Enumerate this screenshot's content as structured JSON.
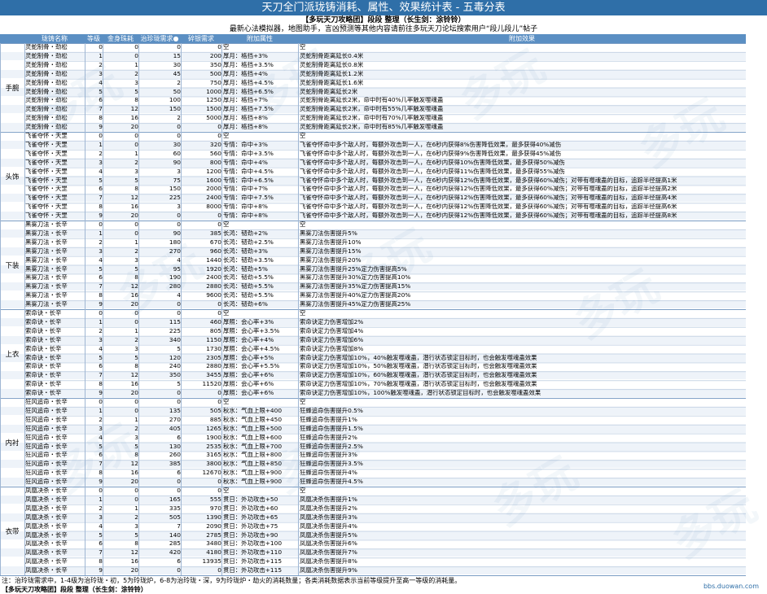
{
  "title": "天刀全门派珑铸消耗、属性、效果统计表 - 五毒分表",
  "credit": "【多玩天刀攻略团】段段 整理（长生剑：涂铃铃）",
  "intro": "最新心法模拟器，地图助手，言凶预测等其他内容请前往多玩天刀论坛搜索用户“段儿段儿”帖子",
  "headers": [
    "珑铸名称",
    "等级",
    "金身珠耗",
    "治珍珑需求●",
    "碎银需求",
    "附加属性",
    "附加效果"
  ],
  "sections": [
    {
      "name": "手腕",
      "item": "灵蛇制骨・劲松",
      "rows": [
        [
          "0",
          "0",
          "0",
          "0",
          "空",
          "空"
        ],
        [
          "1",
          "0",
          "15",
          "200",
          "厚月：格挡+3%",
          "灵蛇制骨距离延长0.4米"
        ],
        [
          "2",
          "1",
          "30",
          "350",
          "厚月：格挡+3.5%",
          "灵蛇制骨距离延长0.8米"
        ],
        [
          "3",
          "2",
          "45",
          "500",
          "厚月：格挡+4%",
          "灵蛇制骨距离延长1.2米"
        ],
        [
          "4",
          "3",
          "2",
          "750",
          "厚月：格挡+4.5%",
          "灵蛇制骨距离延长1.6米"
        ],
        [
          "5",
          "5",
          "50",
          "1000",
          "厚月：格挡+6.5%",
          "灵蛇制骨距离延长2米"
        ],
        [
          "6",
          "8",
          "100",
          "1250",
          "厚月：格挡+7%",
          "灵蛇制骨距离延长2米，命中时有40%几率触发噬魂蛊"
        ],
        [
          "7",
          "12",
          "150",
          "1500",
          "厚月：格挡+7.5%",
          "灵蛇制骨距离延长2米，命中时有55%几率触发噬魂蛊"
        ],
        [
          "8",
          "16",
          "2",
          "5000",
          "厚月：格挡+8%",
          "灵蛇制骨距离延长2米，命中时有70%几率触发噬魂蛊"
        ],
        [
          "9",
          "20",
          "0",
          "0",
          "厚月：格挡+8%",
          "灵蛇制骨距离延长2米，命中时有85%几率触发噬魂蛊"
        ]
      ]
    },
    {
      "name": "头饰",
      "item": "飞雀夺怀・天罡",
      "rows": [
        [
          "0",
          "0",
          "0",
          "0",
          "空",
          "空"
        ],
        [
          "1",
          "0",
          "30",
          "320",
          "专情：命中+3%",
          "飞雀夺怀命中多个敌人时，每额外攻击到一人，在6秒内获得8%伤害降低效果，最多获得40%减伤"
        ],
        [
          "2",
          "1",
          "60",
          "560",
          "专情：命中+3.5%",
          "飞雀夺怀命中多个敌人时，每额外攻击到一人，在6秒内获得9%伤害降低效果，最多获得45%减伤"
        ],
        [
          "3",
          "2",
          "90",
          "800",
          "专情：命中+4%",
          "飞雀夺怀命中多个敌人时，每额外攻击到一人，在6秒内获得10%伤害降低效果，最多获得50%减伤"
        ],
        [
          "4",
          "3",
          "3",
          "1200",
          "专情：命中+4.5%",
          "飞雀夺怀命中多个敌人时，每额外攻击到一人，在6秒内获得11%伤害降低效果，最多获得55%减伤"
        ],
        [
          "5",
          "5",
          "75",
          "1600",
          "专情：命中+6.5%",
          "飞雀夺怀命中多个敌人时，每额外攻击到一人，在6秒内获得12%伤害降低效果，最多获得60%减伤；对带有噬魂蛊的目标，追踪半径提高1米"
        ],
        [
          "6",
          "8",
          "150",
          "2000",
          "专情：命中+7%",
          "飞雀夺怀命中多个敌人时，每额外攻击到一人，在6秒内获得12%伤害降低效果，最多获得60%减伤；对带有噬魂蛊的目标，追踪半径提高2米"
        ],
        [
          "7",
          "12",
          "225",
          "2400",
          "专情：命中+7.5%",
          "飞雀夺怀命中多个敌人时，每额外攻击到一人，在6秒内获得12%伤害降低效果，最多获得60%减伤；对带有噬魂蛊的目标，追踪半径提高4米"
        ],
        [
          "8",
          "16",
          "3",
          "8000",
          "专情：命中+8%",
          "飞雀夺怀命中多个敌人时，每额外攻击到一人，在6秒内获得12%伤害降低效果，最多获得60%减伤；对带有噬魂蛊的目标，追踪半径提高6米"
        ],
        [
          "9",
          "20",
          "0",
          "0",
          "专情：命中+8%",
          "飞雀夺怀命中多个敌人时，每额外攻击到一人，在6秒内获得12%伤害降低效果，最多获得60%减伤；对带有噬魂蛊的目标，追踪半径提高8米"
        ]
      ]
    },
    {
      "name": "下装",
      "item": "黑雾刀法・长辛",
      "rows": [
        [
          "0",
          "0",
          "0",
          "0",
          "空",
          "空"
        ],
        [
          "1",
          "0",
          "90",
          "385",
          "长鸿：韧劲+2%",
          "黑雾刀法伤害提升5%"
        ],
        [
          "2",
          "1",
          "180",
          "670",
          "长鸿：韧劲+2.5%",
          "黑雾刀法伤害提升10%"
        ],
        [
          "3",
          "2",
          "270",
          "960",
          "长鸿：韧劲+3%",
          "黑雾刀法伤害提升15%"
        ],
        [
          "4",
          "3",
          "4",
          "1440",
          "长鸿：韧劲+3.5%",
          "黑雾刀法伤害提升20%"
        ],
        [
          "5",
          "5",
          "95",
          "1920",
          "长鸿：韧劲+5%",
          "黑雾刀法伤害提升25%定力伤害提高5%"
        ],
        [
          "6",
          "8",
          "190",
          "2400",
          "长鸿：韧劲+5.5%",
          "黑雾刀法伤害提升30%定力伤害提高10%"
        ],
        [
          "7",
          "12",
          "280",
          "2880",
          "长鸿：韧劲+5.5%",
          "黑雾刀法伤害提升35%定力伤害提高15%"
        ],
        [
          "8",
          "16",
          "4",
          "9600",
          "长鸿：韧劲+5.5%",
          "黑雾刀法伤害提升40%定力伤害提高20%"
        ],
        [
          "9",
          "20",
          "0",
          "0",
          "长鸿：韧劲+6%",
          "黑雾刀法伤害提升45%定力伤害提高25%"
        ]
      ]
    },
    {
      "name": "上衣",
      "item": "索命诀・长辛",
      "rows": [
        [
          "0",
          "0",
          "0",
          "0",
          "空",
          "空"
        ],
        [
          "1",
          "0",
          "115",
          "460",
          "厚照：会心率+3%",
          "索命诀定力伤害增加2%"
        ],
        [
          "2",
          "1",
          "225",
          "805",
          "厚照：会心率+3.5%",
          "索命诀定力伤害增加4%"
        ],
        [
          "3",
          "2",
          "340",
          "1150",
          "厚照：会心率+4%",
          "索命诀定力伤害增加6%"
        ],
        [
          "4",
          "3",
          "5",
          "1730",
          "厚照：会心率+4.5%",
          "索命诀定力伤害增加8%"
        ],
        [
          "5",
          "5",
          "120",
          "2305",
          "厚照：会心率+5%",
          "索命诀定力伤害增加10%，40%触发噬魂蛊，潜行状态锁定目标时，也会触发噬魂蛊效果"
        ],
        [
          "6",
          "8",
          "240",
          "2880",
          "厚照：会心率+5.5%",
          "索命诀定力伤害增加10%，50%触发噬魂蛊，潜行状态锁定目标时，也会触发噬魂蛊效果"
        ],
        [
          "7",
          "12",
          "350",
          "3455",
          "厚照：会心率+6%",
          "索命诀定力伤害增加10%，60%触发噬魂蛊，潜行状态锁定目标时，也会触发噬魂蛊效果"
        ],
        [
          "8",
          "16",
          "5",
          "11520",
          "厚照：会心率+6%",
          "索命诀定力伤害增加10%，70%触发噬魂蛊，潜行状态锁定目标时，也会触发噬魂蛊效果"
        ],
        [
          "9",
          "20",
          "0",
          "0",
          "厚照：会心率+6%",
          "索命诀定力伤害增加10%，100%触发噬魂蛊，潜行状态锁定目标时，也会触发噬魂蛊效果"
        ]
      ]
    },
    {
      "name": "内衬",
      "item": "狂风追命・长辛",
      "rows": [
        [
          "0",
          "0",
          "0",
          "0",
          "空",
          "空"
        ],
        [
          "1",
          "0",
          "135",
          "505",
          "秋水：气血上限+400",
          "狂蜂追命伤害提升0.5%"
        ],
        [
          "2",
          "1",
          "270",
          "885",
          "秋水：气血上限+450",
          "狂蜂追命伤害提升1%"
        ],
        [
          "3",
          "2",
          "405",
          "1265",
          "秋水：气血上限+500",
          "狂蜂追命伤害提升1.5%"
        ],
        [
          "4",
          "3",
          "6",
          "1900",
          "秋水：气血上限+600",
          "狂蜂追命伤害提升2%"
        ],
        [
          "5",
          "5",
          "130",
          "2535",
          "秋水：气血上限+700",
          "狂蜂追命伤害提升2.5%"
        ],
        [
          "6",
          "8",
          "260",
          "3165",
          "秋水：气血上限+800",
          "狂蜂追命伤害提升3%"
        ],
        [
          "7",
          "12",
          "385",
          "3800",
          "秋水：气血上限+850",
          "狂蜂追命伤害提升3.5%"
        ],
        [
          "8",
          "16",
          "6",
          "12670",
          "秋水：气血上限+900",
          "狂蜂追命伤害提升4%"
        ],
        [
          "9",
          "20",
          "0",
          "0",
          "秋水：气血上限+900",
          "狂蜂追命伤害提升4.5%"
        ]
      ]
    },
    {
      "name": "衣带",
      "item": "凤凰决杀・长辛",
      "rows": [
        [
          "0",
          "0",
          "0",
          "0",
          "空",
          "空"
        ],
        [
          "1",
          "0",
          "165",
          "555",
          "贯日：外功攻击+50",
          "凤凰决杀伤害提升1%"
        ],
        [
          "2",
          "1",
          "335",
          "970",
          "贯日：外功攻击+60",
          "凤凰决杀伤害提升2%"
        ],
        [
          "3",
          "2",
          "505",
          "1390",
          "贯日：外功攻击+65",
          "凤凰决杀伤害提升3%"
        ],
        [
          "4",
          "3",
          "7",
          "2090",
          "贯日：外功攻击+75",
          "凤凰决杀伤害提升4%"
        ],
        [
          "5",
          "5",
          "140",
          "2785",
          "贯日：外功攻击+90",
          "凤凰决杀伤害提升5%"
        ],
        [
          "6",
          "8",
          "285",
          "3480",
          "贯日：外功攻击+100",
          "凤凰决杀伤害提升6%"
        ],
        [
          "7",
          "12",
          "420",
          "4180",
          "贯日：外功攻击+110",
          "凤凰决杀伤害提升7%"
        ],
        [
          "8",
          "16",
          "6",
          "13935",
          "贯日：外功攻击+115",
          "凤凰决杀伤害提升8%"
        ],
        [
          "9",
          "20",
          "0",
          "0",
          "贯日：外功攻击+115",
          "凤凰决杀伤害提升9%"
        ]
      ]
    }
  ],
  "footnote": "注：治玲珑需求中，1-4级为治玲珑・初，5为玲珑炉，6-8为治玲珑・深，9为玲珑炉・劫火的消耗数量；各类消耗数据表示当前等级提升至高一等级的消耗量。",
  "footer_credit": "【多玩天刀攻略团】段段 整理（长生剑：涂铃铃）",
  "url": "bbs.duowan.com",
  "watermark": "多玩"
}
